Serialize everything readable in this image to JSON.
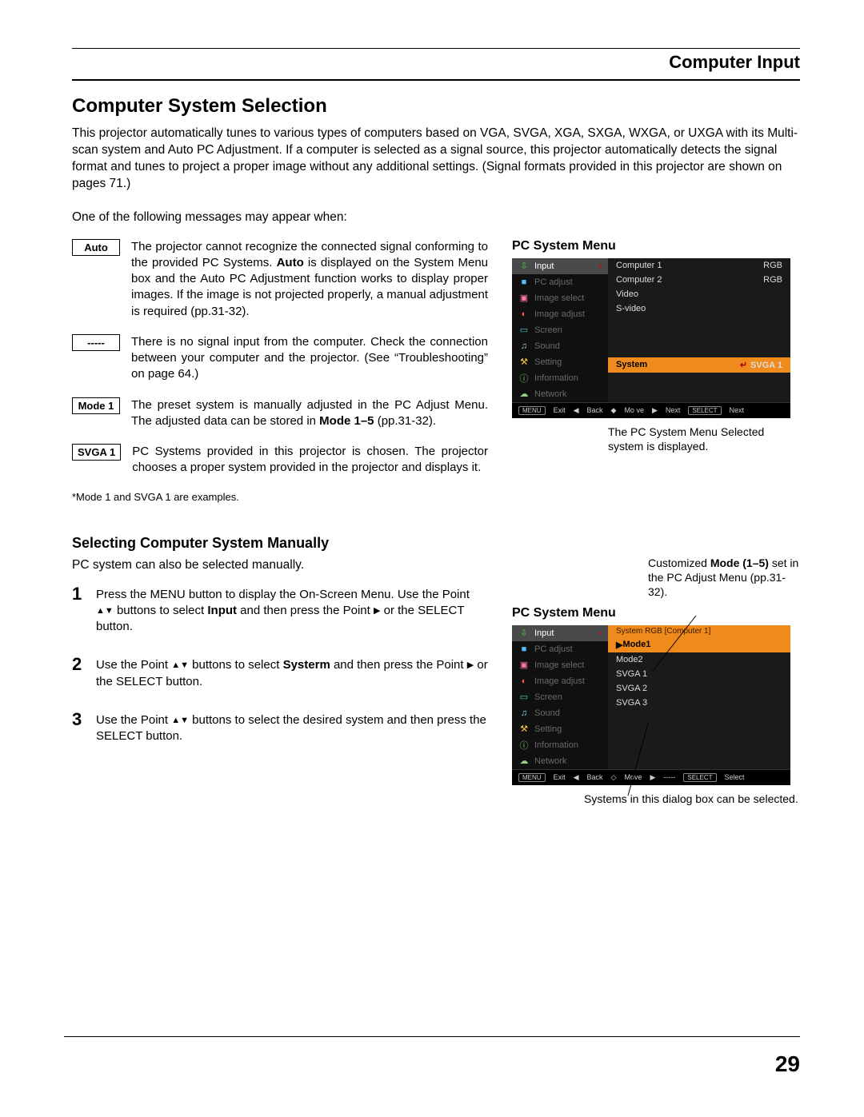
{
  "header": {
    "title": "Computer Input"
  },
  "section_title": "Computer System Selection",
  "intro": "This projector automatically tunes to various types of computers based on VGA, SVGA, XGA, SXGA, WXGA, or UXGA with its Multi-scan system and Auto PC Adjustment. If a computer is selected as a signal source, this projector automatically detects the signal format and tunes to project a proper image without any additional settings. (Signal formats provided in this projector are shown on pages 71.)",
  "lead_line": "One of the following messages may appear when:",
  "messages": [
    {
      "label": "Auto",
      "text_parts": [
        "The projector cannot recognize the connected signal conforming to the provided PC Systems. ",
        "Auto",
        " is displayed on the System Menu box and the Auto PC Adjustment function works to display proper images. If the image is not projected properly, a manual adjustment is required (pp.31-32)."
      ]
    },
    {
      "label": "-----",
      "text": "There is no signal input from the computer. Check the connection between your computer and the projector. (See “Troubleshooting” on page 64.)"
    },
    {
      "label": "Mode 1",
      "text_parts": [
        "The preset system is manually adjusted in the PC Adjust Menu. The adjusted data can be stored in ",
        "Mode 1–5",
        " (pp.31-32)."
      ]
    },
    {
      "label": "SVGA 1",
      "text": "PC Systems provided in this projector is chosen. The projector chooses a proper system provided in the projector and displays it."
    }
  ],
  "example_note": "*Mode 1 and SVGA 1 are examples.",
  "manual_title": "Selecting Computer System Manually",
  "manual_intro": "PC system can also be selected manually.",
  "steps": [
    {
      "num": "1",
      "pre": "Press the MENU button to display the On-Screen Menu. Use the Point ",
      "mid": " buttons to select ",
      "bold": "Input",
      "post": " and then press the Point ",
      "tail": " or the SELECT button."
    },
    {
      "num": "2",
      "pre": "Use the Point ",
      "mid": " buttons to select ",
      "bold": "Systerm",
      "post": " and then press the Point ",
      "tail": " or the SELECT button."
    },
    {
      "num": "3",
      "pre": "Use the Point ",
      "mid": " buttons to select the desired system and then press the SELECT button.",
      "bold": "",
      "post": "",
      "tail": ""
    }
  ],
  "osd_sidebar": [
    {
      "icon": "⇩",
      "cls": "c-green",
      "label": "Input",
      "selected": true
    },
    {
      "icon": "■",
      "cls": "c-blue",
      "label": "PC adjust"
    },
    {
      "icon": "▣",
      "cls": "c-pink",
      "label": "Image select"
    },
    {
      "icon": "◐",
      "cls": "c-red",
      "label": "Image adjust"
    },
    {
      "icon": "▭",
      "cls": "c-teal",
      "label": "Screen"
    },
    {
      "icon": "♫",
      "cls": "c-cyan",
      "label": "Sound"
    },
    {
      "icon": "⚒",
      "cls": "c-ylw",
      "label": "Setting"
    },
    {
      "icon": "ⓘ",
      "cls": "c-grn2",
      "label": "Information"
    },
    {
      "icon": "☁",
      "cls": "c-net",
      "label": "Network"
    }
  ],
  "osd1": {
    "caption": "PC System Menu",
    "rows": [
      {
        "c1": "Computer 1",
        "c2": "RGB"
      },
      {
        "c1": "Computer 2",
        "c2": "RGB"
      },
      {
        "c1": "Video",
        "c2": ""
      },
      {
        "c1": "S-video",
        "c2": ""
      }
    ],
    "system_row": {
      "c1": "System",
      "c2": "SVGA 1",
      "icon": "↵"
    },
    "foot": {
      "exit_pill": "MENU",
      "exit": "Exit",
      "back_tri": "◀",
      "back": "Back",
      "move_tri": "◆",
      "move": "Mo    ve",
      "next_tri": "▶",
      "next": "Next",
      "sel_pill": "SELECT",
      "sel": "Next"
    },
    "annot": "The PC System Menu Selected system is displayed."
  },
  "osd2": {
    "caption": "PC System Menu",
    "annot_top_pre": "Customized ",
    "annot_top_bold": "Mode (1–5)",
    "annot_top_post": " set in the PC Adjust Menu (pp.31-32).",
    "header_row": "System  RGB [Computer 1]",
    "rows": [
      {
        "c1": "Mode1",
        "sel": true,
        "marker": "▶"
      },
      {
        "c1": "Mode2"
      },
      {
        "c1": "SVGA 1"
      },
      {
        "c1": "SVGA 2"
      },
      {
        "c1": "SVGA 3"
      }
    ],
    "foot": {
      "exit_pill": "MENU",
      "exit": "Exit",
      "back_tri": "◀",
      "back": "Back",
      "move_tri": "◇",
      "move": "Move",
      "next_tri": "▶",
      "next": "-----",
      "sel_pill": "SELECT",
      "sel": "Select"
    },
    "annot_bottom": "Systems in this dialog box can be selected."
  },
  "page_number": "29"
}
